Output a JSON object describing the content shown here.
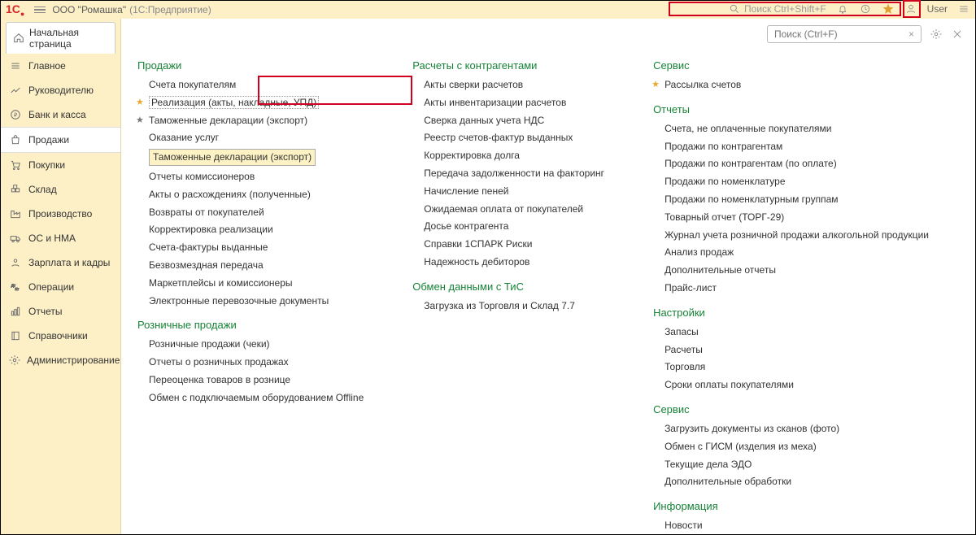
{
  "title": {
    "company": "ООО \"Ромашка\"",
    "app": "(1С:Предприятие)"
  },
  "search_hint": "Поиск Ctrl+Shift+F",
  "user": "User",
  "start_tab": "Начальная страница",
  "sidebar": [
    {
      "id": "main",
      "label": "Главное"
    },
    {
      "id": "manager",
      "label": "Руководителю"
    },
    {
      "id": "bank",
      "label": "Банк и касса"
    },
    {
      "id": "sales",
      "label": "Продажи"
    },
    {
      "id": "purchases",
      "label": "Покупки"
    },
    {
      "id": "warehouse",
      "label": "Склад"
    },
    {
      "id": "production",
      "label": "Производство"
    },
    {
      "id": "assets",
      "label": "ОС и НМА"
    },
    {
      "id": "salary",
      "label": "Зарплата и кадры"
    },
    {
      "id": "operations",
      "label": "Операции"
    },
    {
      "id": "reports",
      "label": "Отчеты"
    },
    {
      "id": "catalogs",
      "label": "Справочники"
    },
    {
      "id": "admin",
      "label": "Администрирование"
    }
  ],
  "search_placeholder": "Поиск (Ctrl+F)",
  "sections": {
    "sales": {
      "title": "Продажи",
      "items": [
        "Счета покупателям",
        "Реализация (акты, накладные, УПД)",
        "Таможенные декларации (экспорт)",
        "Оказание услуг",
        "Таможенные декларации (экспорт)",
        "Отчеты комиссионеров",
        "Акты о расхождениях (полученные)",
        "Возвраты от покупателей",
        "Корректировка реализации",
        "Счета-фактуры выданные",
        "Безвозмездная передача",
        "Маркетплейсы и комиссионеры",
        "Электронные перевозочные документы"
      ]
    },
    "retail": {
      "title": "Розничные продажи",
      "items": [
        "Розничные продажи (чеки)",
        "Отчеты о розничных продажах",
        "Переоценка товаров в рознице",
        "Обмен с подключаемым оборудованием Offline"
      ]
    },
    "settlements": {
      "title": "Расчеты с контрагентами",
      "items": [
        "Акты сверки расчетов",
        "Акты инвентаризации расчетов",
        "Сверка данных учета НДС",
        "Реестр счетов-фактур выданных",
        "Корректировка долга",
        "Передача задолженности на факторинг",
        "Начисление пеней",
        "Ожидаемая оплата от покупателей",
        "Досье контрагента",
        "Справки 1СПАРК Риски",
        "Надежность дебиторов"
      ]
    },
    "exchange": {
      "title": "Обмен данными с ТиС",
      "items": [
        "Загрузка из Торговля и Склад 7.7"
      ]
    },
    "service_top": {
      "title": "Сервис",
      "items": [
        "Рассылка счетов"
      ]
    },
    "reports": {
      "title": "Отчеты",
      "items": [
        "Счета, не оплаченные покупателями",
        "Продажи по контрагентам",
        "Продажи по контрагентам (по оплате)",
        "Продажи по номенклатуре",
        "Продажи по номенклатурным группам",
        "Товарный отчет (ТОРГ-29)",
        "Журнал учета розничной продажи алкогольной продукции",
        "Анализ продаж",
        "Дополнительные отчеты",
        "Прайс-лист"
      ]
    },
    "settings": {
      "title": "Настройки",
      "items": [
        "Запасы",
        "Расчеты",
        "Торговля",
        "Сроки оплаты покупателями"
      ]
    },
    "service": {
      "title": "Сервис",
      "items": [
        "Загрузить документы из сканов (фото)",
        "Обмен с ГИСМ (изделия из меха)",
        "Текущие дела ЭДО",
        "Дополнительные обработки"
      ]
    },
    "info": {
      "title": "Информация",
      "items": [
        "Новости"
      ]
    }
  }
}
